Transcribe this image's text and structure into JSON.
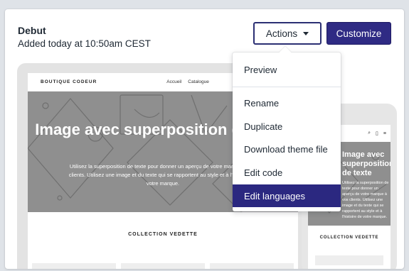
{
  "theme": {
    "name": "Debut",
    "added": "Added today at 10:50am CEST"
  },
  "buttons": {
    "actions_label": "Actions",
    "customize_label": "Customize"
  },
  "menu": {
    "items": [
      {
        "label": "Preview"
      },
      {
        "label": "Rename"
      },
      {
        "label": "Duplicate"
      },
      {
        "label": "Download theme file"
      },
      {
        "label": "Edit code"
      },
      {
        "label": "Edit languages",
        "active": true
      }
    ]
  },
  "preview": {
    "store_name": "BOUTIQUE CODEUR",
    "nav": [
      "Accueil",
      "Catalogue"
    ],
    "hero_title": "Image avec superposition de texte",
    "hero_text": "Utilisez la superposition de texte pour donner un aperçu de votre marque à vos clients. Utilisez une image et du texte qui se rapportent au style et à l'histoire de votre marque.",
    "collection_title": "COLLECTION VEDETTE"
  },
  "phone_preview": {
    "hero_title": "Image avec superposition de texte",
    "hero_text": "Utilisez la superposition de texte pour donner un aperçu de votre marque à vos clients. Utilisez une image et du texte qui se rapportent au style et à l'histoire de votre marque.",
    "collection_title": "COLLECTION VEDETTE",
    "icons": [
      "search-icon",
      "cart-icon",
      "menu-icon"
    ]
  },
  "colors": {
    "primary": "#2f2b84",
    "active_item": "#2b2880",
    "hero_gray": "#8f8f8f"
  }
}
